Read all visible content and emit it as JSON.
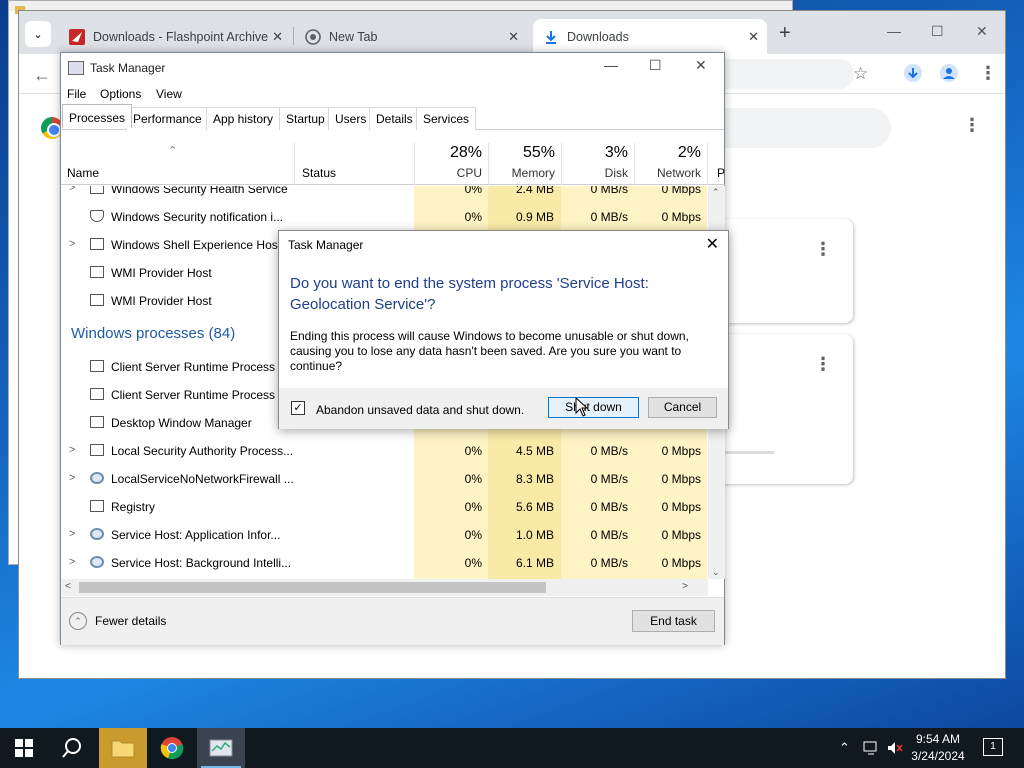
{
  "browser": {
    "tabs": [
      {
        "label": "Downloads - Flashpoint Archive",
        "close": "✕"
      },
      {
        "label": "New Tab",
        "close": "✕"
      },
      {
        "label": "Downloads",
        "close": "✕"
      }
    ],
    "new_tab": "+",
    "window_controls": {
      "minimize": "—",
      "maximize": "☐",
      "close": "✕"
    }
  },
  "task_manager": {
    "title": "Task Manager",
    "menu": [
      "File",
      "Options",
      "View"
    ],
    "tabs": [
      "Processes",
      "Performance",
      "App history",
      "Startup",
      "Users",
      "Details",
      "Services"
    ],
    "active_tab": "Processes",
    "columns": {
      "name": "Name",
      "status": "Status",
      "cpu": {
        "pct": "28%",
        "label": "CPU"
      },
      "memory": {
        "pct": "55%",
        "label": "Memory"
      },
      "disk": {
        "pct": "3%",
        "label": "Disk"
      },
      "network": {
        "pct": "2%",
        "label": "Network"
      },
      "power": {
        "label": "P"
      }
    },
    "group_label": "Windows processes (84)",
    "rows": [
      {
        "name": "Windows Security Health Service",
        "cpu": "0%",
        "mem": "2.4 MB",
        "disk": "0 MB/s",
        "net": "0 Mbps",
        "expandable": true,
        "icon": "window-icon"
      },
      {
        "name": "Windows Security notification i...",
        "cpu": "0%",
        "mem": "0.9 MB",
        "disk": "0 MB/s",
        "net": "0 Mbps",
        "expandable": false,
        "icon": "shield-icon"
      },
      {
        "name": "Windows Shell Experience Host",
        "expandable": true,
        "icon": "window-icon"
      },
      {
        "name": "WMI Provider Host",
        "expandable": false,
        "icon": "wmi-icon"
      },
      {
        "name": "WMI Provider Host",
        "expandable": false,
        "icon": "wmi-icon"
      },
      {
        "name": "Client Server Runtime Process",
        "expandable": false,
        "icon": "window-icon"
      },
      {
        "name": "Client Server Runtime Process",
        "expandable": false,
        "icon": "window-icon"
      },
      {
        "name": "Desktop Window Manager",
        "expandable": false,
        "icon": "window-icon"
      },
      {
        "name": "Local Security Authority Process...",
        "cpu": "0%",
        "mem": "4.5 MB",
        "disk": "0 MB/s",
        "net": "0 Mbps",
        "expandable": true,
        "icon": "window-icon"
      },
      {
        "name": "LocalServiceNoNetworkFirewall ...",
        "cpu": "0%",
        "mem": "8.3 MB",
        "disk": "0 MB/s",
        "net": "0 Mbps",
        "expandable": true,
        "icon": "gear-icon"
      },
      {
        "name": "Registry",
        "cpu": "0%",
        "mem": "5.6 MB",
        "disk": "0 MB/s",
        "net": "0 Mbps",
        "expandable": false,
        "icon": "window-icon"
      },
      {
        "name": "Service Host: Application Infor...",
        "cpu": "0%",
        "mem": "1.0 MB",
        "disk": "0 MB/s",
        "net": "0 Mbps",
        "expandable": true,
        "icon": "gear-icon"
      },
      {
        "name": "Service Host: Background Intelli...",
        "cpu": "0%",
        "mem": "6.1 MB",
        "disk": "0 MB/s",
        "net": "0 Mbps",
        "expandable": true,
        "icon": "gear-icon"
      }
    ],
    "fewer_details": "Fewer details",
    "end_task": "End task"
  },
  "dialog": {
    "title": "Task Manager",
    "question": "Do you want to end the system process 'Service Host: Geolocation Service'?",
    "body": "Ending this process will cause Windows to become unusable or shut down, causing you to lose any data hasn't been saved. Are you sure you want to continue?",
    "checkbox_label": "Abandon unsaved data and shut down.",
    "checkbox_checked": true,
    "checkbox_mark": "✓",
    "shutdown_label": "Shut down",
    "cancel_label": "Cancel",
    "close": "✕"
  },
  "taskbar": {
    "time": "9:54 AM",
    "date": "3/24/2024",
    "notification_count": "1"
  }
}
